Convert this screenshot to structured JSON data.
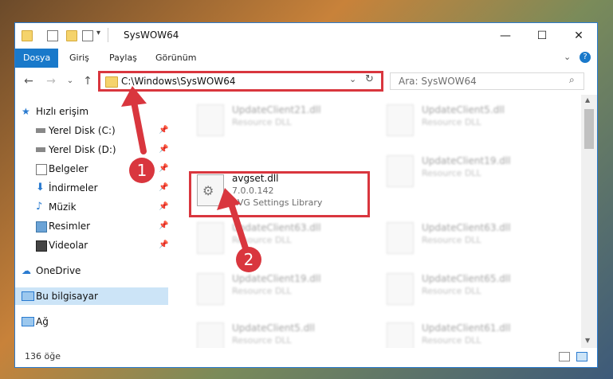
{
  "window": {
    "title": "SysWOW64",
    "minimize": "—",
    "maximize": "☐",
    "close": "✕"
  },
  "ribbon": {
    "tabs": [
      "Dosya",
      "Giriş",
      "Paylaş",
      "Görünüm"
    ],
    "help": "?"
  },
  "address": {
    "path": "C:\\Windows\\SysWOW64",
    "search_placeholder": "Ara: SysWOW64"
  },
  "nav": {
    "items": [
      {
        "label": "Hızlı erişim",
        "icon": "star-icon"
      },
      {
        "label": "Yerel Disk (C:)",
        "icon": "drive-icon"
      },
      {
        "label": "Yerel Disk (D:)",
        "icon": "drive-icon"
      },
      {
        "label": "Belgeler",
        "icon": "document-icon"
      },
      {
        "label": "İndirmeler",
        "icon": "download-icon"
      },
      {
        "label": "Müzik",
        "icon": "music-icon"
      },
      {
        "label": "Resimler",
        "icon": "pictures-icon"
      },
      {
        "label": "Videolar",
        "icon": "video-icon"
      },
      {
        "label": "OneDrive",
        "icon": "cloud-icon"
      },
      {
        "label": "Bu bilgisayar",
        "icon": "computer-icon"
      },
      {
        "label": "Ağ",
        "icon": "network-icon"
      }
    ]
  },
  "files": [
    {
      "name": "UpdateClient21.dll",
      "desc": "Resource DLL"
    },
    {
      "name": "UpdateClient5.dll",
      "desc": "Resource DLL"
    },
    {
      "name": "UpdateClient19.dll",
      "desc": "Resource DLL"
    },
    {
      "name": "UpdateClient63.dll",
      "desc": "Resource DLL"
    },
    {
      "name": "UpdateClient63.dll",
      "desc": "Resource DLL"
    },
    {
      "name": "UpdateClient19.dll",
      "desc": "Resource DLL"
    },
    {
      "name": "UpdateClient65.dll",
      "desc": "Resource DLL"
    },
    {
      "name": "UpdateClient5.dll",
      "desc": "Resource DLL"
    },
    {
      "name": "UpdateClient61.dll",
      "desc": "Resource DLL"
    }
  ],
  "selected_file": {
    "name": "avgset.dll",
    "version": "7.0.0.142",
    "desc": "AVG Settings Library"
  },
  "status": {
    "count": "136 öğe"
  },
  "markers": {
    "one": "1",
    "two": "2"
  },
  "colors": {
    "accent": "#1979ca",
    "highlight": "#d9363e"
  }
}
